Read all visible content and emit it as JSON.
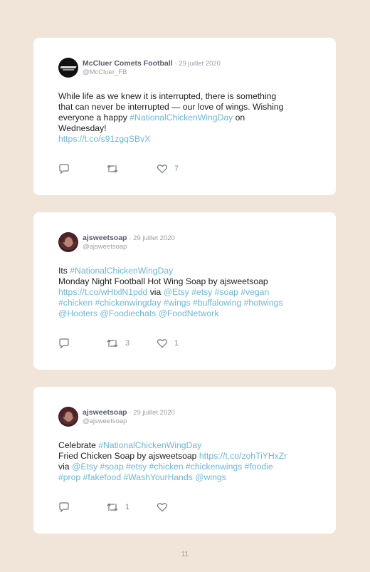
{
  "tweets": [
    {
      "name": "McCluer Comets Football",
      "date": "· 29 juillet 2020",
      "handle": "@McCluer_FB",
      "lines": [
        [
          {
            "t": "While life as we knew it is interrupted, there is something"
          }
        ],
        [
          {
            "t": "that can never be interrupted — our love of wings. Wishing"
          }
        ],
        [
          {
            "t": "everyone a happy "
          },
          {
            "t": "#NationalChickenWingDay",
            "link": true
          },
          {
            "t": " on"
          }
        ],
        [
          {
            "t": "Wednesday!"
          }
        ],
        [
          {
            "t": "https://t.co/s91zgqSBvX",
            "link": true
          }
        ]
      ],
      "retweets": "",
      "likes": "7"
    },
    {
      "name": "ajsweetsoap",
      "date": "· 29 juillet 2020",
      "handle": "@ajsweetsoap",
      "lines": [
        [
          {
            "t": "Its "
          },
          {
            "t": "#NationalChickenWingDay",
            "link": true
          }
        ],
        [
          {
            "t": "Monday Night Football Hot Wing Soap by ajsweetsoap"
          }
        ],
        [
          {
            "t": "https://t.co/wHtxlN1pdd",
            "link": true
          },
          {
            "t": " via "
          },
          {
            "t": "@Etsy #etsy #soap #vegan",
            "link": true
          }
        ],
        [
          {
            "t": "#chicken #chickenwingday #wings #buffalowing #hotwings",
            "link": true
          }
        ],
        [
          {
            "t": "@Hooters @Foodiechats @FoodNetwork",
            "link": true
          }
        ]
      ],
      "retweets": "3",
      "likes": "1"
    },
    {
      "name": "ajsweetsoap",
      "date": "· 29 juillet 2020",
      "handle": "@ajsweetsoap",
      "lines": [
        [
          {
            "t": "Celebrate "
          },
          {
            "t": "#NationalChickenWingDay",
            "link": true
          }
        ],
        [
          {
            "t": "Fried Chicken Soap by ajsweetsoap "
          },
          {
            "t": "https://t.co/zohTiYHxZr",
            "link": true
          }
        ],
        [
          {
            "t": "via "
          },
          {
            "t": "@Etsy #soap #etsy #chicken #chickenwings #foodie",
            "link": true
          }
        ],
        [
          {
            "t": "#prop #fakefood #WashYourHands @wings",
            "link": true
          }
        ]
      ],
      "retweets": "1",
      "likes": ""
    }
  ],
  "icons": {
    "reply": "reply-icon",
    "retweet": "retweet-icon",
    "like": "heart-icon"
  },
  "page_number": "11"
}
